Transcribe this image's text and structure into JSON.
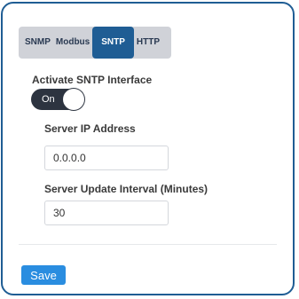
{
  "tabs": [
    {
      "label": "SNMP",
      "active": false
    },
    {
      "label": "Modbus",
      "active": false
    },
    {
      "label": "SNTP",
      "active": true
    },
    {
      "label": "HTTP",
      "active": false
    }
  ],
  "form": {
    "activate_label": "Activate SNTP Interface",
    "toggle": {
      "label": "On",
      "state": "on"
    },
    "server_ip_label": "Server IP Address",
    "server_ip_value": "0.0.0.0",
    "interval_label": "Server Update Interval (Minutes)",
    "interval_value": "30"
  },
  "actions": {
    "save_label": "Save"
  },
  "colors": {
    "border": "#1f5d94",
    "active_tab": "#1f5d94",
    "tab_bar": "#d0d2d8",
    "toggle_on": "#2d3440",
    "save_button": "#2a8de0"
  }
}
